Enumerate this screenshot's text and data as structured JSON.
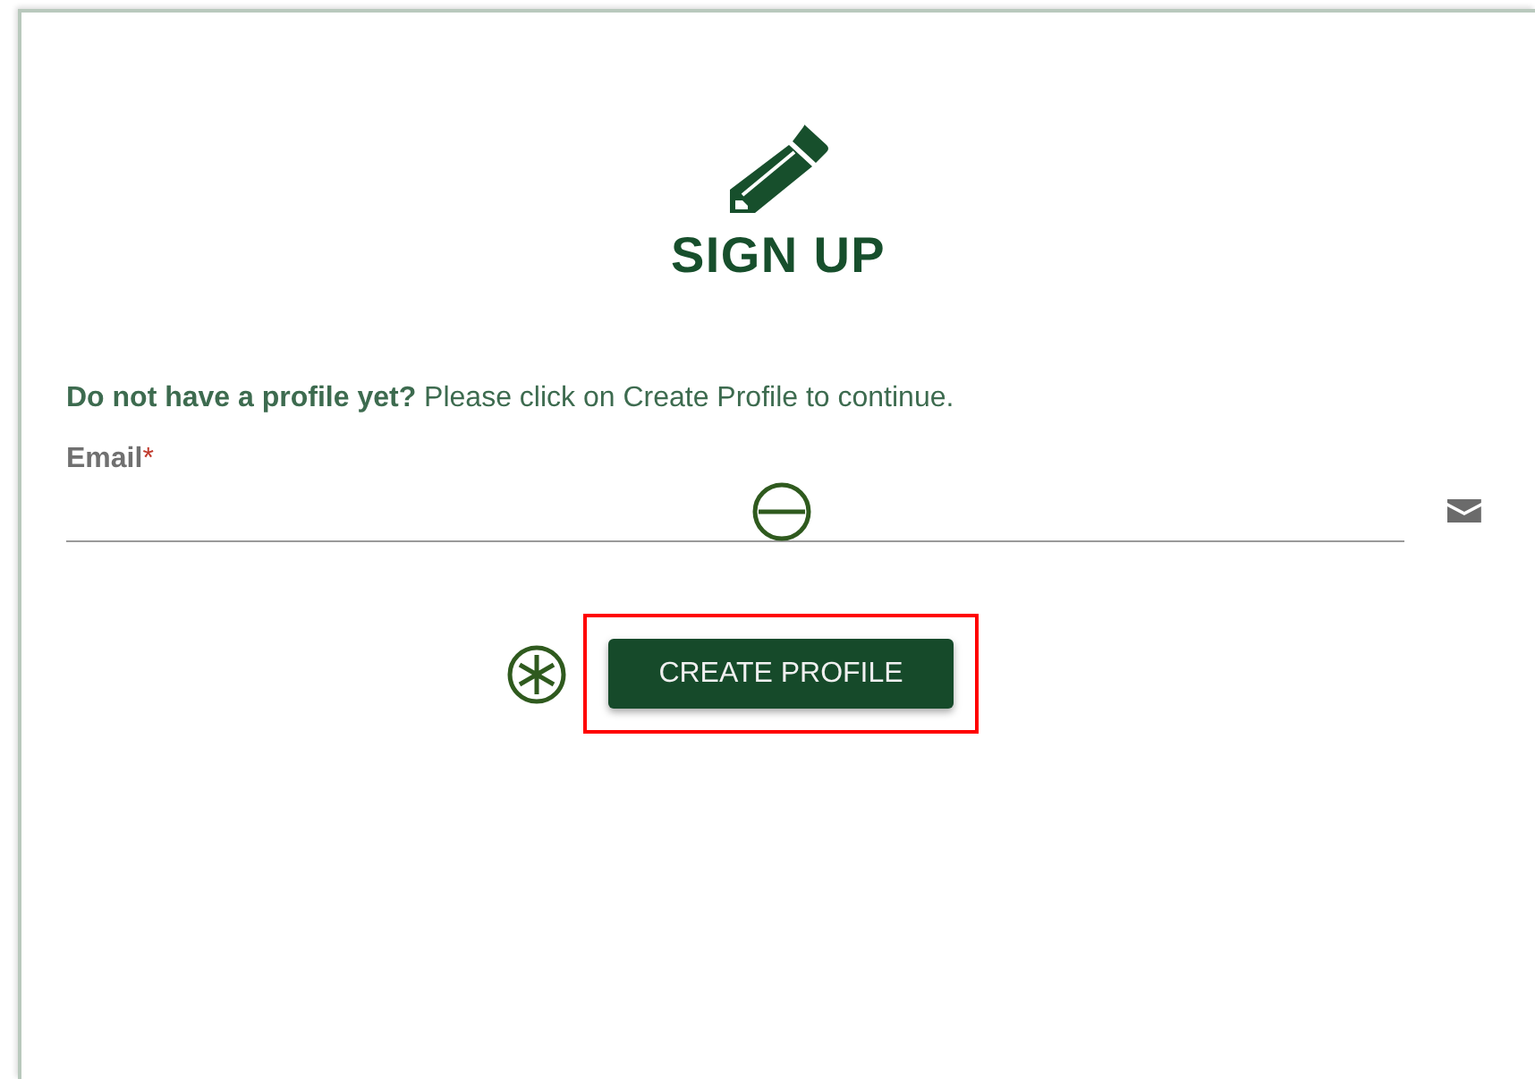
{
  "title": "SIGN UP",
  "intro": "**Do not have a profile yet?** Please click on Create Profile to continue.",
  "email_field": {
    "label": "Email",
    "required": true,
    "required_mark": "*"
  },
  "button": {
    "label": "CREATE PROFILE",
    "highlighted": true
  }
}
